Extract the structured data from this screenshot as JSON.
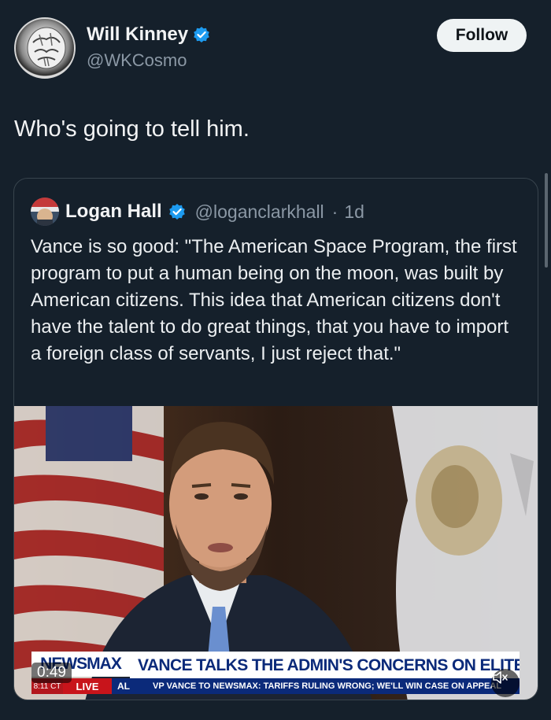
{
  "author": {
    "name": "Will Kinney",
    "handle": "@WKCosmo",
    "verified": true
  },
  "follow_label": "Follow",
  "tweet_text": "Who's going to tell him.",
  "quoted_tweet": {
    "name": "Logan Hall",
    "handle": "@loganclarkhall",
    "separator": "·",
    "time": "1d",
    "text": "Vance is so good: \"The American Space Program, the first program to put a human being on the moon, was built by American citizens. This idea that American citizens don't have the talent to do great things, that you have to import a foreign class of servants, I just reject that.\""
  },
  "video": {
    "duration": "0:49",
    "chyron_logo": "NEWSMAX",
    "chyron_headline": "VANCE TALKS THE ADMIN'S CONCERNS ON ELITE EDUCATION",
    "chyron_time": "8:11 CT",
    "chyron_live": "LIVE",
    "chyron_segment": "AL",
    "chyron_ticker": "VP VANCE TO NEWSMAX: TARIFFS RULING WRONG; WE'LL WIN CASE ON APPEAL"
  },
  "colors": {
    "background": "#15202b",
    "verified_blue": "#1d9bf0",
    "secondary_text": "#8b98a5"
  }
}
